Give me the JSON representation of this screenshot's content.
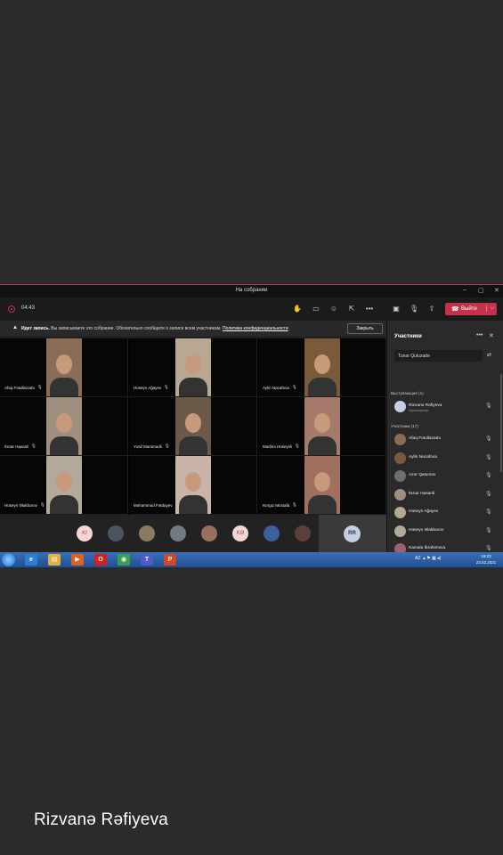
{
  "window": {
    "title": "На собрании",
    "minimize": "–",
    "restore": "▢",
    "close": "✕"
  },
  "toolbar": {
    "timer": "04:43",
    "leave_label": "Выйти",
    "leave_chevron": "⌵",
    "icons": [
      "hand-raise-icon",
      "chat-icon",
      "reactions-icon",
      "share-icon",
      "more-icon",
      "camera-icon",
      "mic-icon",
      "share-screen-icon"
    ]
  },
  "banner": {
    "title": "Идет запись.",
    "text": "Вы записываете это собрание. Обязательно сообщите о записи всем участникам.",
    "link": "Политика конфиденциальности",
    "close_label": "Закрыть"
  },
  "tiles": [
    {
      "name": "Afaq Fətullazadə",
      "color": "#8a6d57"
    },
    {
      "name": "Hüseyn Ağayev",
      "color": "#b8a891"
    },
    {
      "name": "Aylin Nacafova",
      "color": "#7a5a3a"
    },
    {
      "name": "Ilxnar Hasanli",
      "color": "#9e8f7f"
    },
    {
      "name": "Yusif Məmmədli",
      "color": "#6b5a4a"
    },
    {
      "name": "Mədinə Hüseynli",
      "color": "#a57a6a"
    },
    {
      "name": "Hüseyn Əlakbərov",
      "color": "#b1a99a"
    },
    {
      "name": "Məhəmməd Fətdayev",
      "color": "#c9b4aa"
    },
    {
      "name": "Nərgiz Mustafa",
      "color": "#9f7060"
    }
  ],
  "strip": [
    {
      "initials": "KI",
      "bg": "#f3d6d8",
      "fg": "#b0394a"
    },
    {
      "initials": "",
      "bg": "#4a5560",
      "fg": "#fff"
    },
    {
      "initials": "",
      "bg": "#8a7a60",
      "fg": "#fff"
    },
    {
      "initials": "",
      "bg": "#6f7a82",
      "fg": "#fff"
    },
    {
      "initials": "",
      "bg": "#987060",
      "fg": "#fff"
    },
    {
      "initials": "KƏ",
      "bg": "#f3d6d8",
      "fg": "#b0394a"
    },
    {
      "initials": "",
      "bg": "#3a60a0",
      "fg": "#fff"
    },
    {
      "initials": "",
      "bg": "#5a4038",
      "fg": "#fff"
    }
  ],
  "self_view": {
    "initials": "RR"
  },
  "participants": {
    "title": "Участники",
    "search_value": "Tunar Quluzadə",
    "presenters_label": "Выступающие (1)",
    "attendees_label": "Участники (17)",
    "presenter": {
      "name": "Rizvanə Rəfiyeva",
      "sub": "Организатор",
      "color": "#c6cfe6"
    },
    "attendees": [
      {
        "name": "Afaq Fətullazadə",
        "color": "#8a6d57",
        "mic": "🎙"
      },
      {
        "name": "Aylin Nacafova",
        "color": "#7a5a3a",
        "mic": "🎙"
      },
      {
        "name": "Azər Qasımov",
        "color": "#6b6f73",
        "mic": "🎙"
      },
      {
        "name": "Ilxnar Hasanli",
        "color": "#9e8f7f",
        "mic": "🎙"
      },
      {
        "name": "Hüseyn Ağayev",
        "color": "#b8a891",
        "mic": "🎙"
      },
      {
        "name": "Hüseyn Əlakbərov",
        "color": "#b1a99a",
        "mic": "🎙"
      },
      {
        "name": "Kamala İbrahimova",
        "color": "#a06070",
        "mic": "🎙"
      }
    ]
  },
  "taskbar": {
    "apps": [
      "e",
      "▤",
      "▶",
      "O",
      "◉",
      "T",
      "P"
    ],
    "tray_lang": "AZ",
    "time": "19:23",
    "date": "23.02.2021"
  },
  "caption": "Rizvanə Rəfiyeva"
}
